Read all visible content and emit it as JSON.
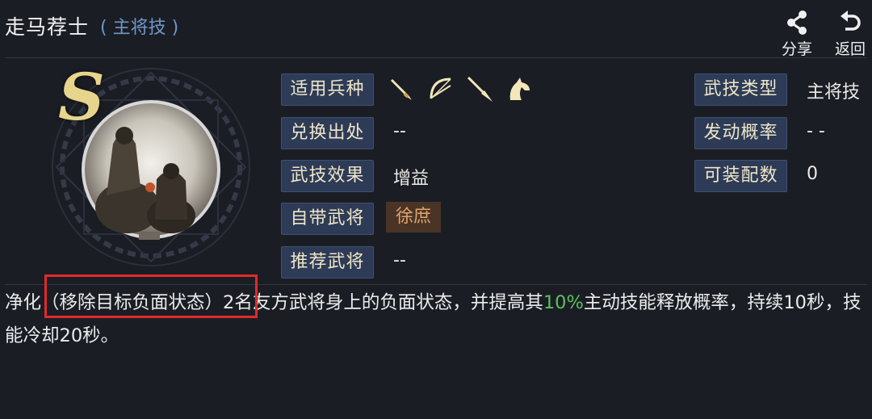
{
  "header": {
    "title": "走马荐士",
    "subtitle": "( 主将技 )",
    "share_label": "分享",
    "back_label": "返回"
  },
  "portrait": {
    "grade": "S"
  },
  "info_left": [
    {
      "label": "适用兵种",
      "value": ""
    },
    {
      "label": "兑换出处",
      "value": "--"
    },
    {
      "label": "武技效果",
      "value": "增益"
    },
    {
      "label": "自带武将",
      "value": "徐庶"
    },
    {
      "label": "推荐武将",
      "value": "--"
    }
  ],
  "unit_types": [
    "blade-icon",
    "bow-icon",
    "spear-icon",
    "horse-icon"
  ],
  "info_right": [
    {
      "label": "武技类型",
      "value": "主将技"
    },
    {
      "label": "发动概率",
      "value": "- -"
    },
    {
      "label": "可装配数",
      "value": "0"
    }
  ],
  "description": {
    "part1": "净化（移除目标负面状态）2名友方武将身上的负面状态，并提高其",
    "highlight": "10%",
    "part2": "主动技能释放概率，持续10秒，技能冷却20秒。"
  },
  "colors": {
    "background": "#1b1d25",
    "label_box": "#2d3b57",
    "accent_green": "#5cc05a",
    "subtitle_blue": "#6e97c9",
    "annotation_red": "#e12a2a"
  }
}
